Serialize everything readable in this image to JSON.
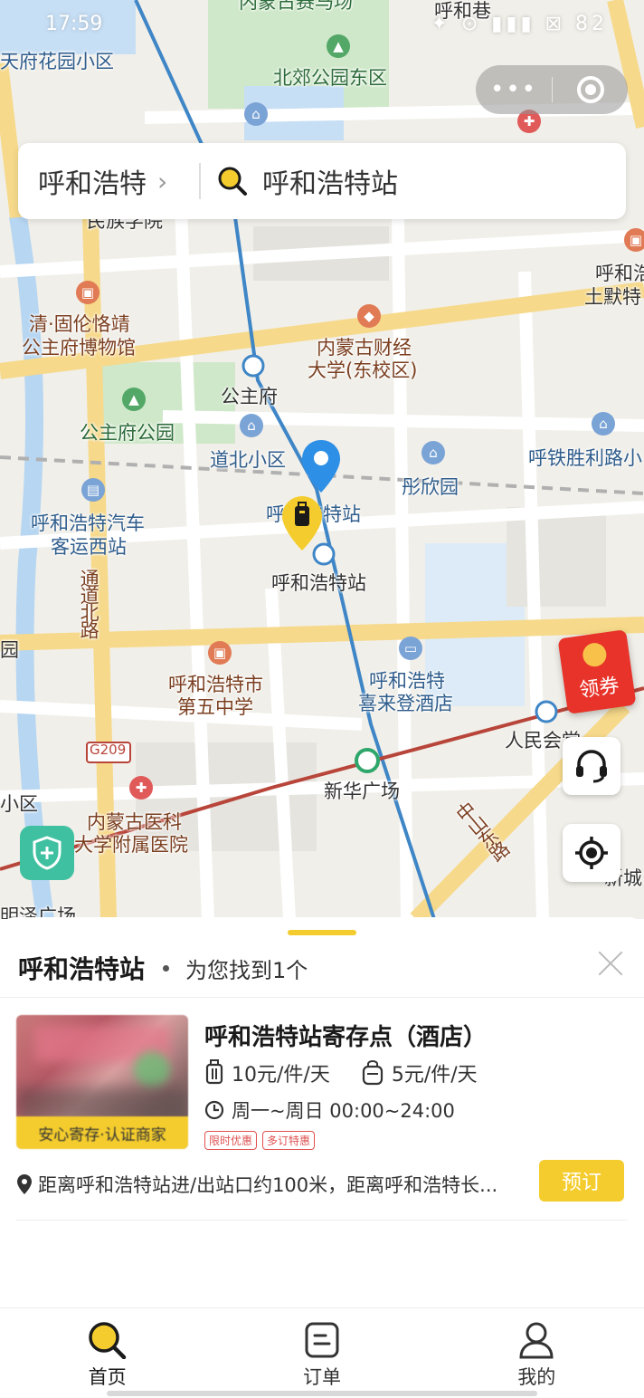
{
  "status_bar": {
    "time": "17:59",
    "icons": "✦ ⊙ ▮▮▮ ⊠ 82"
  },
  "capsule": {
    "more_label": "•••"
  },
  "search": {
    "city": "呼和浩特",
    "query": "呼和浩特站"
  },
  "map": {
    "labels": {
      "tianfu": "天府花园小区",
      "beijiao": "北郊公园东区",
      "huhe_top": "呼和巷",
      "neimeng_top": "内蒙古赛马场",
      "minzu": "民族学院",
      "qing": "清·固伦恪靖",
      "museum": "公主府博物馆",
      "caijing1": "内蒙古财经",
      "caijing2": "大学(东校区)",
      "gongzhufu": "公主府",
      "gongzhufu_park": "公主府公园",
      "daobei": "道北小区",
      "tongxin": "彤欣园",
      "tiesheng": "呼铁胜利路小",
      "zhan_top": "呼和浩特站",
      "zhan_bottom": "呼和浩特站",
      "bus1": "呼和浩特汽车",
      "bus2": "客运西站",
      "tongdao": "通道北路",
      "school1": "呼和浩特市",
      "school2": "第五中学",
      "hotel1": "呼和浩特",
      "hotel2": "喜来登酒店",
      "renmin": "人民会堂",
      "xinhua": "新华广场",
      "g209": "G209",
      "hosp1": "内蒙古医科",
      "hosp2": "大学附属医院",
      "zhongshan": "中山东路",
      "right1": "呼和浩",
      "right2": "土默特",
      "xincheng": "新城",
      "yuan": "园",
      "qu": "小区",
      "jiguang": "明泽广场"
    },
    "redpacket": "领券"
  },
  "sheet": {
    "title": "呼和浩特站",
    "count": "为您找到1个",
    "store": {
      "name": "呼和浩特站寄存点（酒店）",
      "badge": "安心寄存·认证商家",
      "price_large": "10元/件/天",
      "price_small": "5元/件/天",
      "hours": "周一~周日 00:00~24:00",
      "tags": [
        "限时优惠",
        "多订特惠"
      ],
      "address": "距离呼和浩特站进/出站口约100米，距离呼和浩特长...",
      "book_label": "预订"
    }
  },
  "tabbar": {
    "home": "首页",
    "orders": "订单",
    "mine": "我的"
  },
  "colors": {
    "accent": "#f4cc2d",
    "metro": "#3f86c7",
    "rail_red": "#b8453a"
  }
}
